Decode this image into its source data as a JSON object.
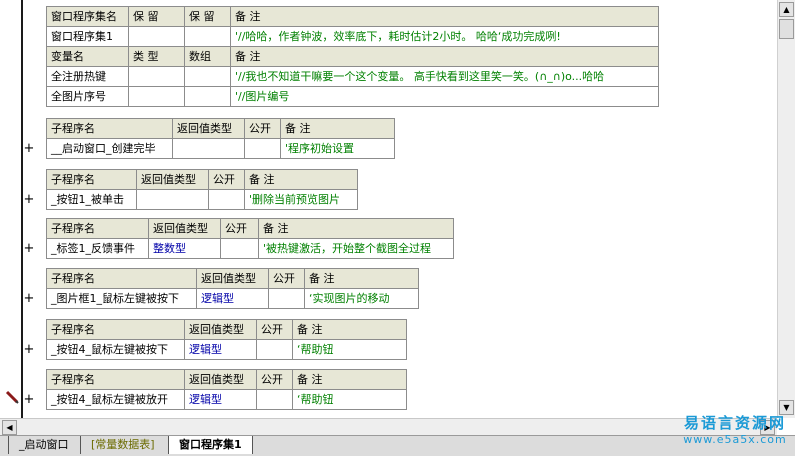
{
  "header_table": {
    "cols": [
      "窗口程序集名",
      "保 留",
      "保 留",
      "备 注"
    ],
    "row": [
      "窗口程序集1",
      "",
      "",
      "'//哈哈，作者钟波，效率底下，耗时估计2小时。 哈哈‘成功完成咧!"
    ],
    "var_cols": [
      "变量名",
      "类 型",
      "数组",
      "备 注"
    ],
    "var_rows": [
      [
        "全注册热键",
        "",
        "",
        "'//我也不知道干嘛要一个这个变量。 高手快看到这里笑一笑。(∩_∩)o...哈哈"
      ],
      [
        "全图片序号",
        "",
        "",
        "'//图片编号"
      ]
    ]
  },
  "sub_header": [
    "子程序名",
    "返回值类型",
    "公开",
    "备 注"
  ],
  "subs": [
    {
      "name": "__启动窗口_创建完毕",
      "ret": "",
      "pub": "",
      "note": "'程序初始设置"
    },
    {
      "name": "_按钮1_被单击",
      "ret": "",
      "pub": "",
      "note": "'删除当前预览图片"
    },
    {
      "name": "_标签1_反馈事件",
      "ret": "整数型",
      "pub": "",
      "note": "'被热键激活，开始整个截图全过程"
    },
    {
      "name": "_图片框1_鼠标左键被按下",
      "ret": "逻辑型",
      "pub": "",
      "note": "‘实现图片的移动"
    },
    {
      "name": "_按钮4_鼠标左键被按下",
      "ret": "逻辑型",
      "pub": "",
      "note": "‘帮助钮"
    },
    {
      "name": "_按钮4_鼠标左键被放开",
      "ret": "逻辑型",
      "pub": "",
      "note": "‘帮助钮"
    }
  ],
  "expand_symbol": "+",
  "tabs": [
    "_启动窗口",
    "[常量数据表]",
    "窗口程序集1"
  ],
  "watermark": {
    "line1": "易语言资源网",
    "line2": "www.e5a5x.com"
  },
  "scroll": {
    "up": "▲",
    "down": "▼",
    "left": "◀",
    "right": "▶"
  },
  "colors": {
    "header_bg": "#e7e7d6",
    "comment": "#008000",
    "type": "#0000a8",
    "watermark": "#1b9ad6"
  }
}
